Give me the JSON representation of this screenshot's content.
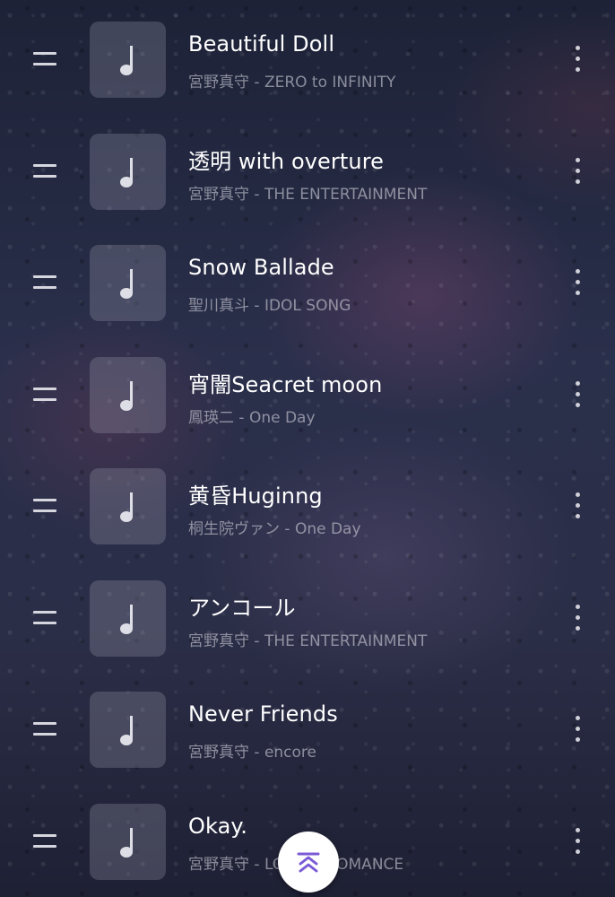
{
  "songs": [
    {
      "title": "Beautiful Doll",
      "subtitle": "宮野真守 - ZERO to INFINITY"
    },
    {
      "title": "透明 with overture",
      "subtitle": "宮野真守 - THE ENTERTAINMENT"
    },
    {
      "title": "Snow Ballade",
      "subtitle": "聖川真斗 - IDOL SONG"
    },
    {
      "title": "宵闇Seacret moon",
      "subtitle": "鳳瑛二 - One Day"
    },
    {
      "title": "黄昏Huginng",
      "subtitle": "桐生院ヴァン - One Day"
    },
    {
      "title": "アンコール",
      "subtitle": "宮野真守 - THE ENTERTAINMENT"
    },
    {
      "title": "Never Friends",
      "subtitle": "宮野真守 - encore"
    },
    {
      "title": "Okay.",
      "subtitle": "宮野真守 - LOVE & ROMANCE"
    }
  ],
  "icons": {
    "drag": "drag-handle-icon",
    "thumb": "music-note-icon",
    "more": "more-vertical-icon",
    "fab": "double-chevron-up-icon"
  },
  "colors": {
    "accent": "#7b5bd6",
    "title_text": "#ffffff",
    "subtitle_text": "#a9aab6"
  }
}
